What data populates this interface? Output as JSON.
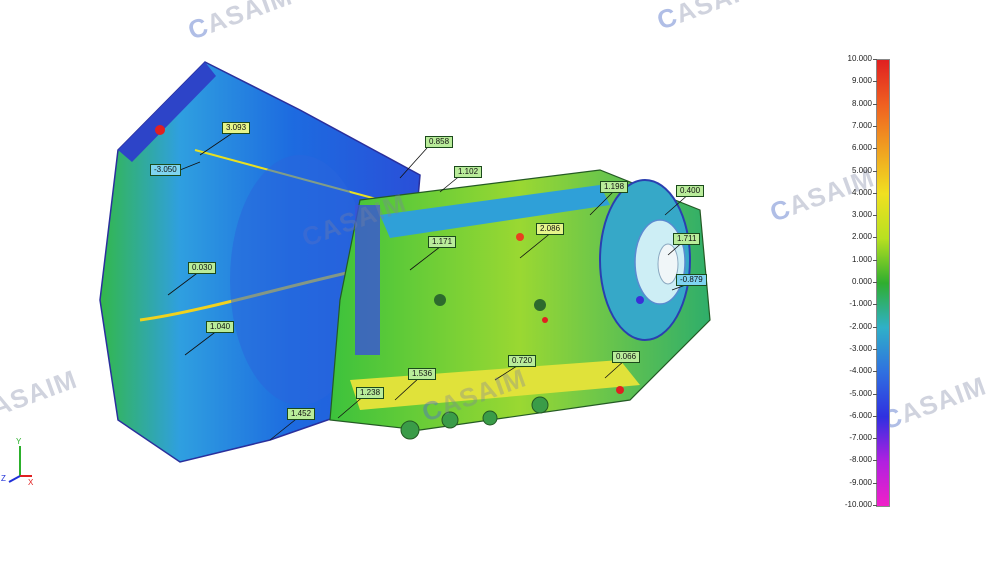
{
  "watermark": {
    "brand": "CASAIM",
    "mark_initial": "C",
    "mark_rest": "ASAIM"
  },
  "callouts": [
    {
      "id": "c1",
      "value": "3.093",
      "tone": "pos"
    },
    {
      "id": "c2",
      "value": "-3.050",
      "tone": "neg"
    },
    {
      "id": "c3",
      "value": "0.858",
      "tone": "mid"
    },
    {
      "id": "c4",
      "value": "1.102",
      "tone": "mid"
    },
    {
      "id": "c5",
      "value": "1.198",
      "tone": "mid"
    },
    {
      "id": "c6",
      "value": "0.400",
      "tone": "mid"
    },
    {
      "id": "c7",
      "value": "1.171",
      "tone": "mid"
    },
    {
      "id": "c8",
      "value": "2.086",
      "tone": "pos"
    },
    {
      "id": "c9",
      "value": "1.711",
      "tone": "mid"
    },
    {
      "id": "c10",
      "value": "-0.879",
      "tone": "neg"
    },
    {
      "id": "c11",
      "value": "0.030",
      "tone": "mid"
    },
    {
      "id": "c12",
      "value": "1.040",
      "tone": "mid"
    },
    {
      "id": "c13",
      "value": "0.720",
      "tone": "mid"
    },
    {
      "id": "c14",
      "value": "0.066",
      "tone": "mid"
    },
    {
      "id": "c15",
      "value": "1.536",
      "tone": "mid"
    },
    {
      "id": "c16",
      "value": "1.238",
      "tone": "mid"
    },
    {
      "id": "c17",
      "value": "1.452",
      "tone": "mid"
    }
  ],
  "legend": {
    "ticks": [
      "10.000",
      "9.000",
      "8.000",
      "7.000",
      "6.000",
      "5.000",
      "4.000",
      "3.000",
      "2.000",
      "1.000",
      "0.000",
      "-1.000",
      "-2.000",
      "-3.000",
      "-4.000",
      "-5.000",
      "-6.000",
      "-7.000",
      "-8.000",
      "-9.000",
      "-10.000"
    ],
    "max": 10,
    "min": -10
  },
  "axes": {
    "y_label": "Y",
    "x_label": "X",
    "z_label": "Z"
  },
  "colors": {
    "accent_pos": "#e02020",
    "neutral": "#2fae2f",
    "accent_neg": "#1f3de0",
    "extreme_neg": "#f020c8"
  }
}
